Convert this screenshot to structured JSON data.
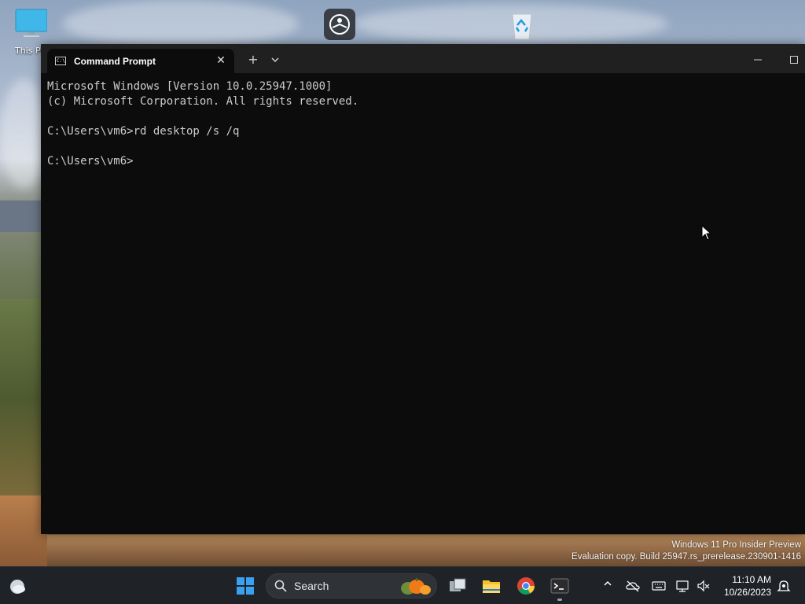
{
  "desktop": {
    "icons": [
      {
        "label": "This PC",
        "icon": "monitor-icon"
      },
      {
        "label": "",
        "icon": "accessibility-app-icon"
      },
      {
        "label": "",
        "icon": "recycle-bin-icon"
      }
    ]
  },
  "terminal": {
    "tab_title": "Command Prompt",
    "tab_icon": "cmd-icon",
    "new_tab_label": "+",
    "dropdown_label": "⌄",
    "minimize_label": "—",
    "maximize_label": "☐",
    "lines": [
      "Microsoft Windows [Version 10.0.25947.1000]",
      "(c) Microsoft Corporation. All rights reserved.",
      "",
      "C:\\Users\\vm6>rd desktop /s /q",
      "",
      "C:\\Users\\vm6>"
    ]
  },
  "watermark": {
    "line1": "Windows 11 Pro Insider Preview",
    "line2": "Evaluation copy. Build 25947.rs_prerelease.230901-1416"
  },
  "taskbar": {
    "search_label": "Search",
    "apps": [
      "start-icon",
      "search-icon",
      "task-view-icon",
      "file-explorer-icon",
      "chrome-icon",
      "terminal-icon"
    ],
    "clock_time": "11:10 AM",
    "clock_date": "10/26/2023",
    "tray_icons": [
      "chevron-up-icon",
      "onedrive-offline-icon",
      "keyboard-icon",
      "network-icon",
      "volume-muted-icon",
      "notification-icon"
    ]
  },
  "colors": {
    "console_bg": "#0c0c0c",
    "console_text": "#cccccc",
    "titlebar_bg": "#202020",
    "taskbar_bg": "#1f2226"
  }
}
